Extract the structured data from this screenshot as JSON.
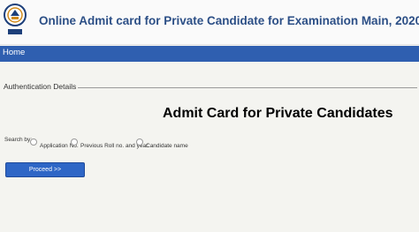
{
  "header": {
    "title": "Online Admit card for Private Candidate for Examination Main, 2020"
  },
  "nav": {
    "home_label": "Home"
  },
  "auth": {
    "legend": "Authentication Details",
    "page_title": "Admit Card for Private Candidates",
    "search_label": "Search by:",
    "options": [
      "Application No.",
      "Previous Roll no. and year",
      "Candidate name"
    ],
    "proceed_label": "Proceed >>"
  },
  "colors": {
    "title": "#2c4f86",
    "navbar": "#2f5fb0",
    "button": "#2e66c6"
  }
}
